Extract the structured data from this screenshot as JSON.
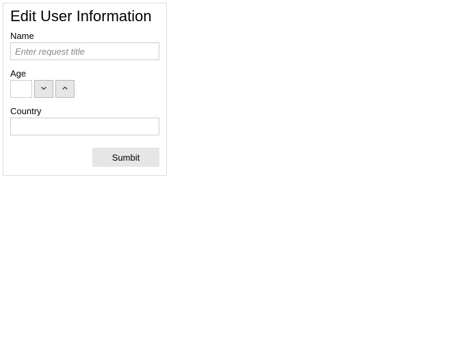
{
  "panel": {
    "title": "Edit User Information"
  },
  "fields": {
    "name": {
      "label": "Name",
      "value": "",
      "placeholder": "Enter request title"
    },
    "age": {
      "label": "Age",
      "value": ""
    },
    "country": {
      "label": "Country",
      "value": ""
    }
  },
  "actions": {
    "submit_label": "Sumbit"
  }
}
